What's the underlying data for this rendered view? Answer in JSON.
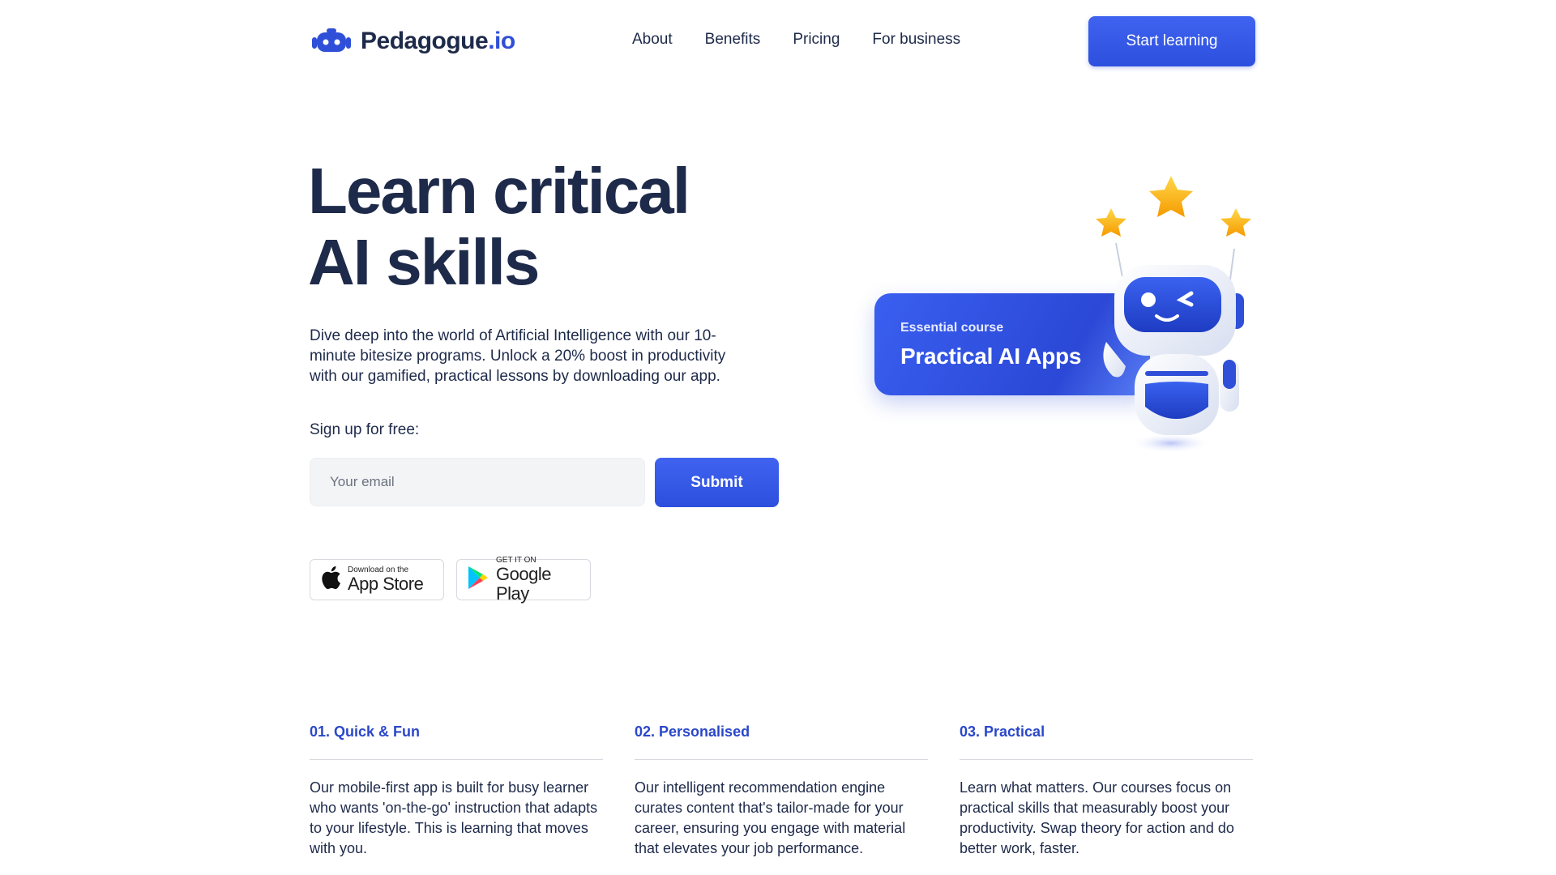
{
  "header": {
    "logo_name": "Pedagogue",
    "logo_tld": ".io",
    "nav": [
      {
        "label": "About"
      },
      {
        "label": "Benefits"
      },
      {
        "label": "Pricing"
      },
      {
        "label": "For business"
      }
    ],
    "cta_label": "Start learning"
  },
  "hero": {
    "title_line1": "Learn critical",
    "title_line2": "AI skills",
    "description": "Dive deep into the world of Artificial Intelligence with our 10-minute bitesize programs. Unlock a 20% boost in productivity with our gamified, practical lessons by downloading our app.",
    "signup_label": "Sign up for free:",
    "email_placeholder": "Your email",
    "submit_label": "Submit"
  },
  "stores": {
    "apple_small": "Download on the",
    "apple_big": "App Store",
    "google_small": "GET IT ON",
    "google_big": "Google Play"
  },
  "course_card": {
    "eyebrow": "Essential course",
    "name": "Practical AI Apps"
  },
  "features": [
    {
      "title": "01. Quick & Fun",
      "text": "Our mobile-first app is built for busy learner who wants 'on-the-go' instruction that adapts to your lifestyle. This is learning that moves with you."
    },
    {
      "title": "02. Personalised",
      "text": "Our intelligent recommendation engine curates content that's tailor-made for your career, ensuring you engage with material that elevates your job performance."
    },
    {
      "title": "03. Practical",
      "text": "Learn what matters. Our courses focus on practical skills that measurably boost your productivity. Swap theory for action and do better work, faster."
    }
  ],
  "colors": {
    "brand_blue": "#2f4fd8",
    "text_dark": "#1e2a4a",
    "star_gold": "#f7b500"
  }
}
